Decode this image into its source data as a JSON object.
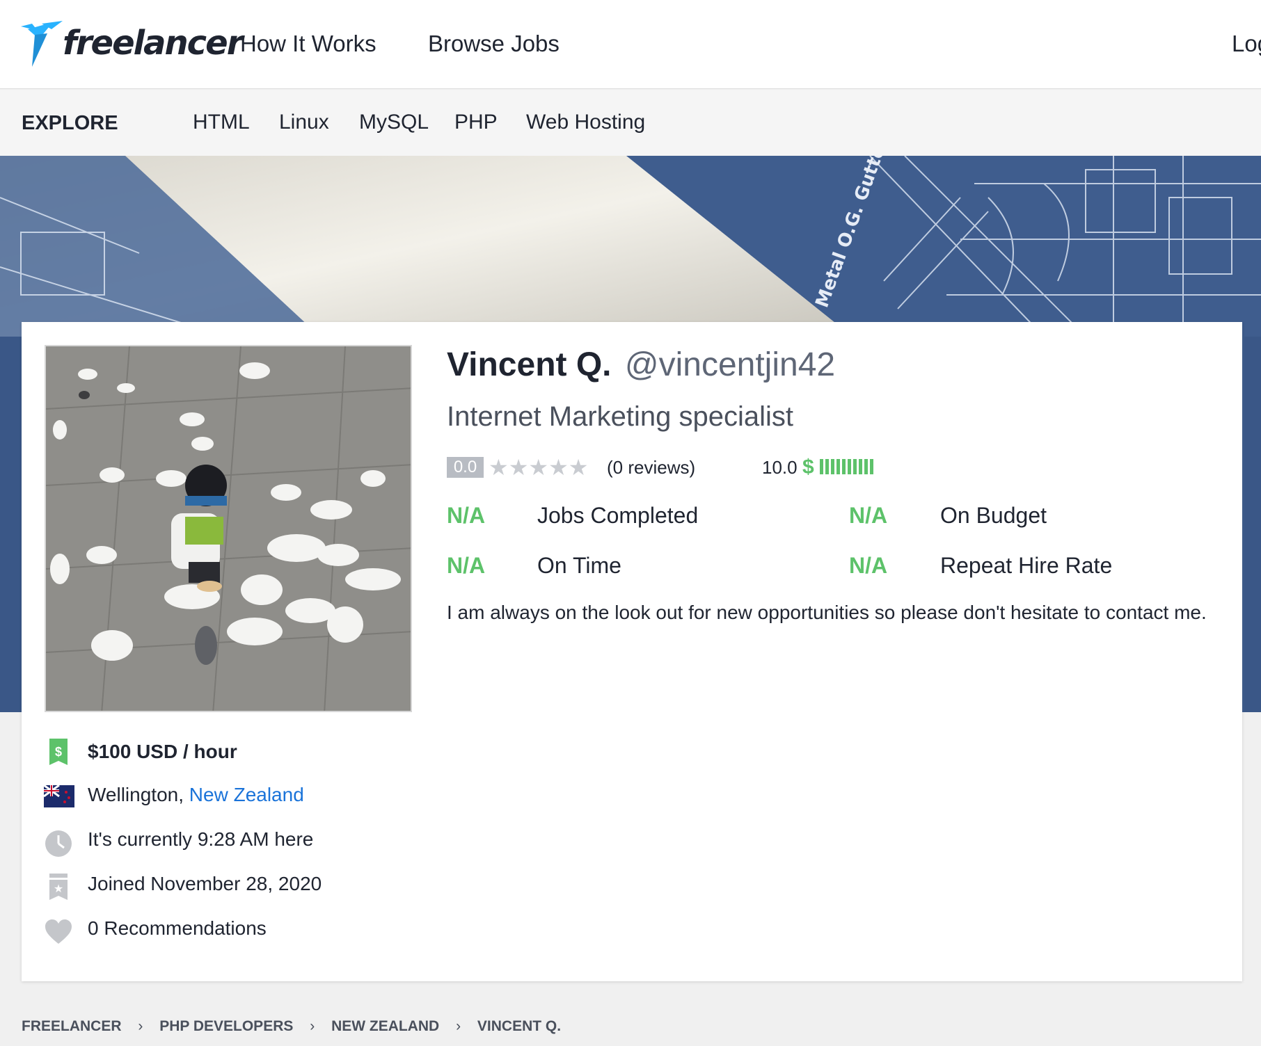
{
  "header": {
    "brand": "freelancer",
    "nav": [
      "How It Works",
      "Browse Jobs",
      "Log"
    ]
  },
  "explore": {
    "title": "EXPLORE",
    "links": [
      "HTML",
      "Linux",
      "MySQL",
      "PHP",
      "Web Hosting"
    ]
  },
  "banner": {
    "blueprint_text": "Metal O.G. Gutter"
  },
  "profile": {
    "name": "Vincent Q.",
    "handle": "@vincentjin42",
    "tagline": "Internet Marketing specialist",
    "rating": "0.0",
    "stars": "★★★★★",
    "reviews": "(0 reviews)",
    "earnings_score": "10.0",
    "earnings_symbol": "$",
    "stats": [
      {
        "value": "N/A",
        "label": "Jobs Completed"
      },
      {
        "value": "N/A",
        "label": "On Budget"
      },
      {
        "value": "N/A",
        "label": "On Time"
      },
      {
        "value": "N/A",
        "label": "Repeat Hire Rate"
      }
    ],
    "about": "I am always on the look out for new opportunities so please don't hesitate to contact me."
  },
  "meta": {
    "rate": "$100 USD / hour",
    "city": "Wellington, ",
    "country": "New Zealand",
    "local_time": "It's currently 9:28 AM here",
    "joined": "Joined November 28, 2020",
    "recommendations": "0 Recommendations"
  },
  "breadcrumb": [
    "FREELANCER",
    "PHP DEVELOPERS",
    "NEW ZEALAND",
    "VINCENT Q."
  ],
  "colors": {
    "accent_green": "#5dc26a",
    "link_blue": "#1a73d9",
    "brand_blue": "#29b2fe",
    "banner_blue": "#3f5d8e"
  },
  "icons": {
    "rate": "money-tag-icon",
    "location": "nz-flag-icon",
    "time": "clock-icon",
    "joined": "badge-star-icon",
    "recommendations": "heart-icon"
  }
}
